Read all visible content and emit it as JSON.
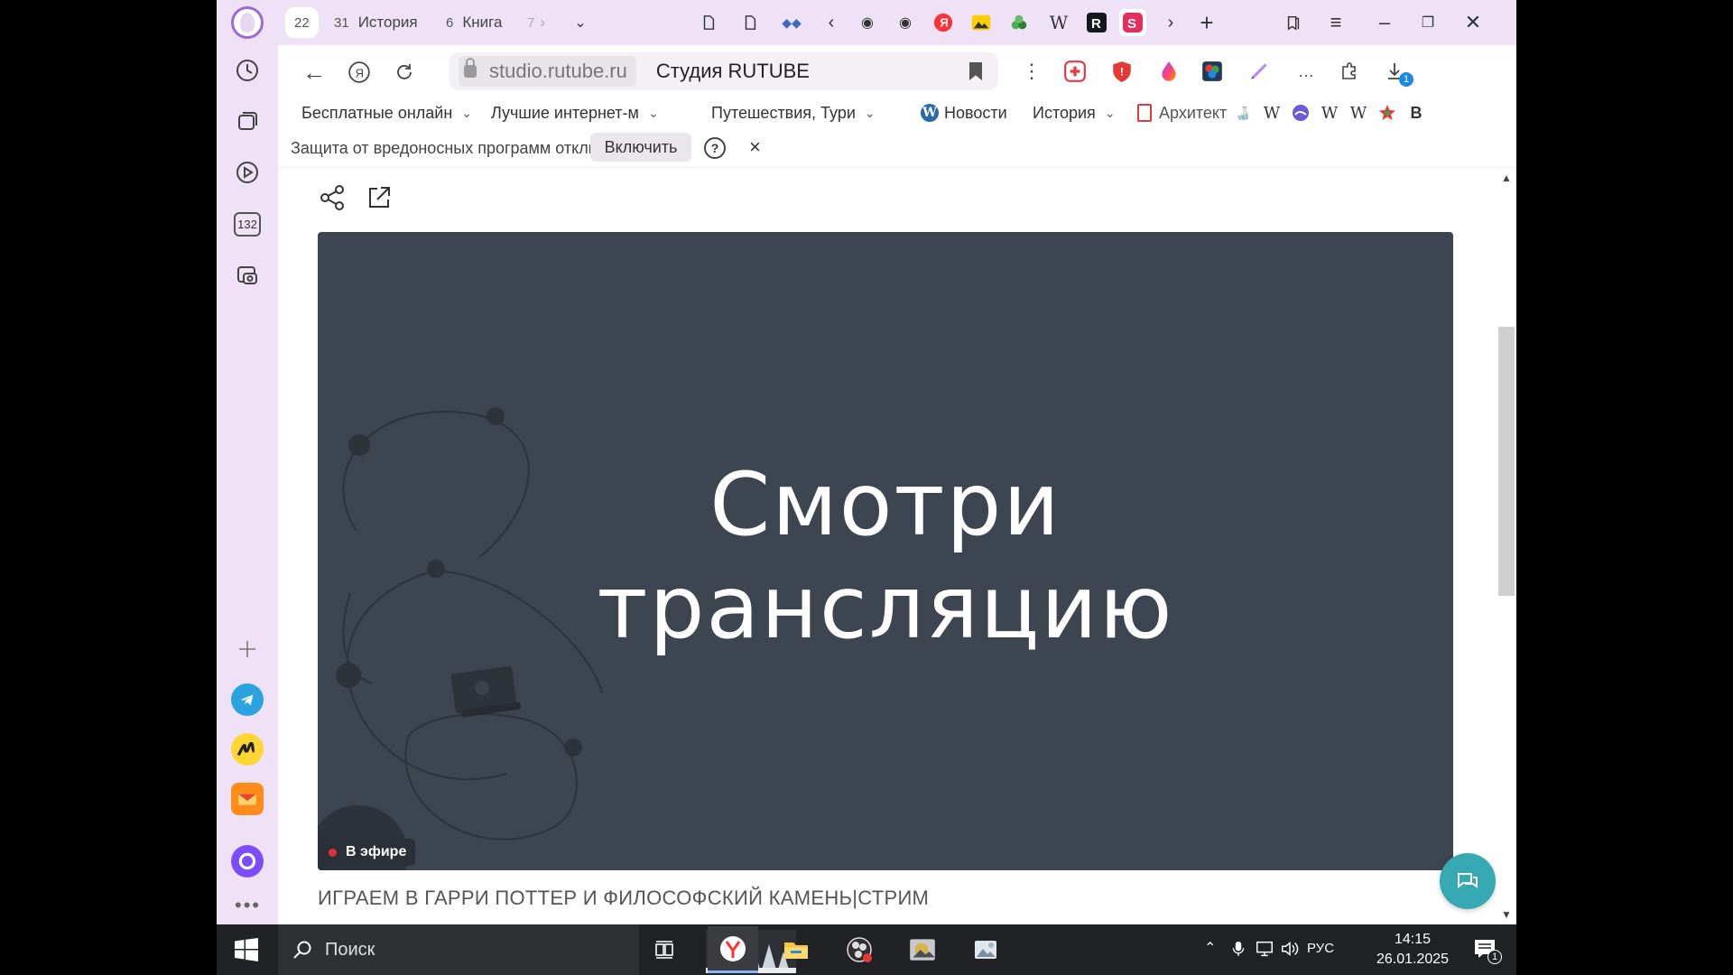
{
  "browser": {
    "tabs": [
      {
        "count": "22",
        "label": ""
      },
      {
        "count": "31",
        "label": "История"
      },
      {
        "count": "6",
        "label": "Книга"
      },
      {
        "count": "7",
        "label": ""
      }
    ],
    "address": {
      "url": "studio.rutube.ru",
      "title": "Студия RUTUBE"
    },
    "bookmarks": [
      {
        "label": "Бесплатные онлайн"
      },
      {
        "label": "Лучшие интернет-м"
      },
      {
        "label": "Путешествия, Тури"
      },
      {
        "label": "Новости"
      },
      {
        "label": "История"
      },
      {
        "label": "Архитект"
      }
    ],
    "bookmark_icons": [
      "W",
      "W",
      "W",
      "B"
    ],
    "sidebar_counter": "132",
    "download_badge": "1"
  },
  "protection_bar": {
    "text": "Защита от вредоносных программ отключена",
    "enable_label": "Включить",
    "help_label": "?",
    "close_label": "×"
  },
  "player": {
    "headline_line1": "Смотри",
    "headline_line2": "трансляцию",
    "live_label": "В эфире",
    "stream_title": "ИГРАЕМ В ГАРРИ ПОТТЕР И ФИЛОСОФСКИЙ КАМЕНЬ|СТРИМ"
  },
  "taskbar": {
    "search_placeholder": "Поиск",
    "language": "РУС",
    "time": "14:15",
    "date": "26.01.2025",
    "notification_count": "1"
  },
  "colors": {
    "sidebar_bg": "#efe1f6",
    "player_bg": "#3d4650",
    "live_dot": "#e62e3f",
    "chat_fab": "#36a9b3",
    "taskbar_bg": "#202225"
  }
}
